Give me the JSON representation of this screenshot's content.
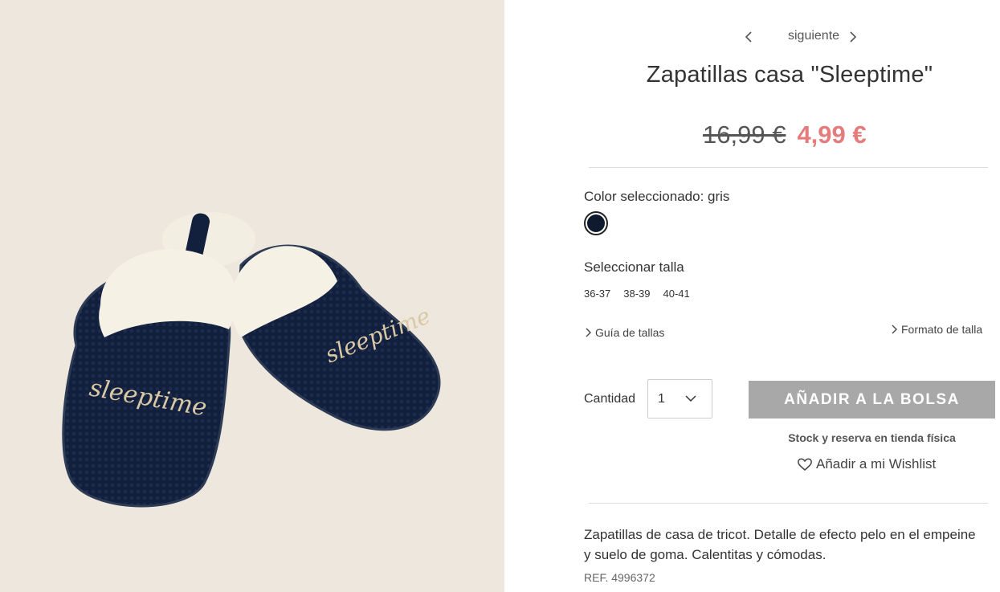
{
  "product": {
    "title": "Zapatillas casa \"Sleeptime\"",
    "old_price": "16,99 €",
    "new_price": "4,99 €",
    "embroidery_text": "sleeptime",
    "color_label": "Color seleccionado: gris",
    "color_swatch": "#0f1a2e",
    "size_label": "Seleccionar talla",
    "sizes": [
      "36-37",
      "38-39",
      "40-41"
    ],
    "description": "Zapatillas de casa de tricot. Detalle de efecto pelo en el empeine y suelo de goma. Calentitas y cómodas.",
    "ref": "REF. 4996372"
  },
  "nav": {
    "next_label": "siguiente"
  },
  "links": {
    "size_guide": "Guía de tallas",
    "size_format": "Formato de talla"
  },
  "purchase": {
    "quantity_label": "Cantidad",
    "quantity_value": "1",
    "add_button": "AÑADIR A LA BOLSA",
    "stock_link": "Stock y reserva en tienda física",
    "wishlist": "Añadir a mi Wishlist"
  },
  "colors": {
    "sale_price": "#e57b7b",
    "button_bg": "#a8a8a8",
    "image_bg": "#eee7de"
  }
}
